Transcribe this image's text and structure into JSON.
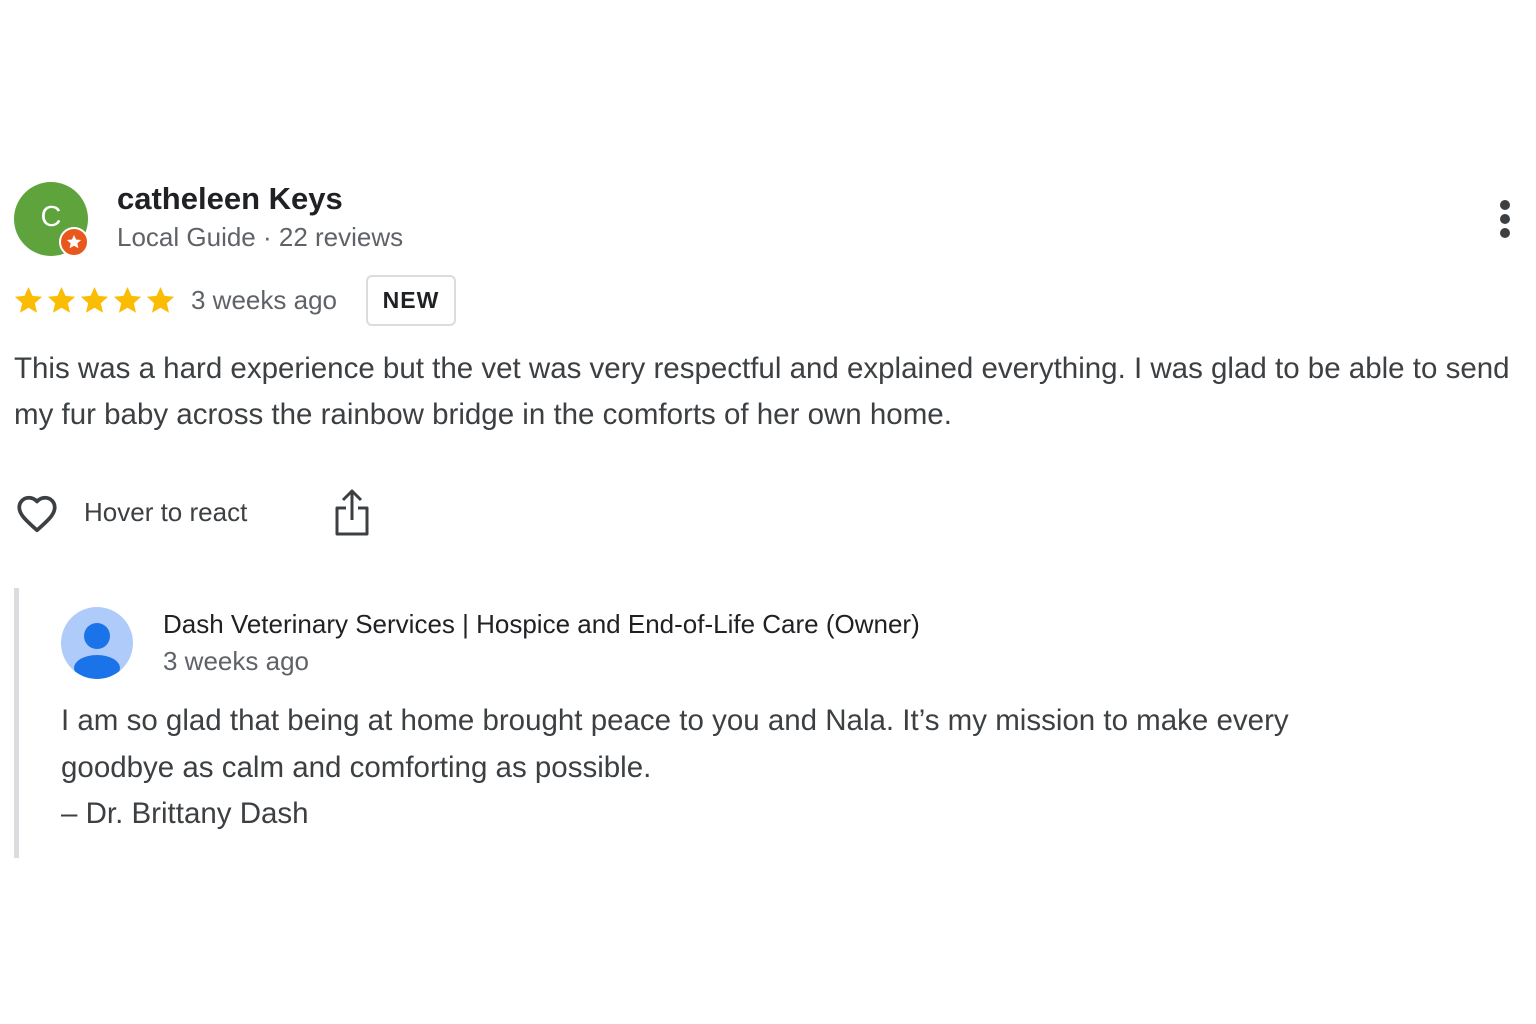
{
  "review": {
    "avatar_letter": "C",
    "avatar_color": "#5ea33b",
    "badge_icon": "local-guide-star-icon",
    "reviewer_name": "catheleen Keys",
    "reviewer_meta": "Local Guide · 22 reviews",
    "rating": 5,
    "rating_max": 5,
    "star_color": "#fbbc04",
    "date": "3 weeks ago",
    "new_badge": "NEW",
    "text": "This was a hard experience but the vet was very respectful and explained everything. I was glad to be able to send my fur baby across the rainbow bridge in the comforts of her own home.",
    "react_label": "Hover to react",
    "icons": {
      "more": "more-vert-icon",
      "react": "heart-outline-icon",
      "share": "share-icon"
    }
  },
  "reply": {
    "owner_name": "Dash Veterinary Services | Hospice and End-of-Life Care (Owner)",
    "date": "3 weeks ago",
    "avatar_icon": "default-profile-icon",
    "avatar_color": "#aecbfa",
    "text_lines": [
      "I am so glad that being at home brought peace to you and Nala. It’s my mission to make every",
      "goodbye as calm and comforting as possible.",
      "– Dr. Brittany Dash"
    ]
  }
}
